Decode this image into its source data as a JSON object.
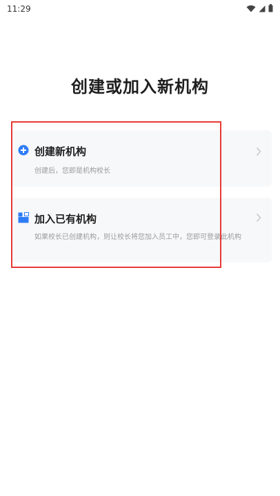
{
  "status_bar": {
    "time": "11:29",
    "icons": [
      "wifi-icon",
      "signal-icon",
      "battery-icon"
    ]
  },
  "page": {
    "title": "创建或加入新机构"
  },
  "options": [
    {
      "icon": "plus-circle-icon",
      "title": "创建新机构",
      "description": "创建后，您即是机构校长"
    },
    {
      "icon": "join-org-icon",
      "title": "加入已有机构",
      "description": "如果校长已创建机构，则让校长将您加入员工中，您即可登录此机构"
    }
  ],
  "colors": {
    "accent": "#2f7df6",
    "highlight_border": "#e53935",
    "card_background": "#f7f8fa",
    "muted_text": "#9a9a9a"
  }
}
